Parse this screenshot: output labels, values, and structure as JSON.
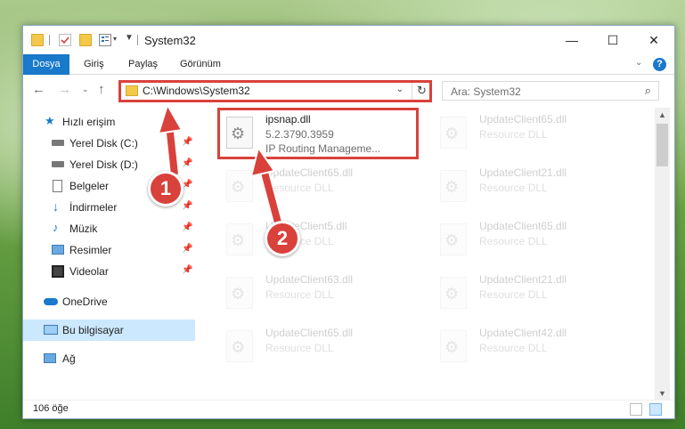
{
  "window": {
    "title": "System32",
    "controls": {
      "minimize": "—",
      "maximize": "☐",
      "close": "✕"
    }
  },
  "ribbon": {
    "tabs": [
      {
        "label": "Dosya"
      },
      {
        "label": "Giriş"
      },
      {
        "label": "Paylaş"
      },
      {
        "label": "Görünüm"
      }
    ],
    "help": "?"
  },
  "address": {
    "path": "C:\\Windows\\System32",
    "search_placeholder": "Ara: System32"
  },
  "sidebar": {
    "items": [
      {
        "label": "Hızlı erişim",
        "icon": "star-icon",
        "pinned": false
      },
      {
        "label": "Yerel Disk (C:)",
        "icon": "drive-icon",
        "pinned": true
      },
      {
        "label": "Yerel Disk (D:)",
        "icon": "drive-icon",
        "pinned": true
      },
      {
        "label": "Belgeler",
        "icon": "documents-icon",
        "pinned": true
      },
      {
        "label": "İndirmeler",
        "icon": "download-icon",
        "pinned": true
      },
      {
        "label": "Müzik",
        "icon": "music-icon",
        "pinned": true
      },
      {
        "label": "Resimler",
        "icon": "pictures-icon",
        "pinned": true
      },
      {
        "label": "Videolar",
        "icon": "video-icon",
        "pinned": true
      },
      {
        "label": "OneDrive",
        "icon": "cloud-icon",
        "pinned": false
      },
      {
        "label": "Bu bilgisayar",
        "icon": "computer-icon",
        "pinned": false,
        "selected": true
      },
      {
        "label": "Ağ",
        "icon": "network-icon",
        "pinned": false
      }
    ]
  },
  "files": [
    {
      "name": "ipsnap.dll",
      "line2": "5.2.3790.3959",
      "line3": "IP Routing Manageme...",
      "highlighted": true
    },
    {
      "name": "UpdateClient65.dll",
      "line2": "Resource DLL"
    },
    {
      "name": "UpdateClient65.dll",
      "line2": "Resource DLL"
    },
    {
      "name": "UpdateClient21.dll",
      "line2": "Resource DLL"
    },
    {
      "name": "UpdateClient5.dll",
      "line2": "Resource DLL"
    },
    {
      "name": "UpdateClient65.dll",
      "line2": "Resource DLL"
    },
    {
      "name": "UpdateClient63.dll",
      "line2": "Resource DLL"
    },
    {
      "name": "UpdateClient21.dll",
      "line2": "Resource DLL"
    },
    {
      "name": "UpdateClient65.dll",
      "line2": "Resource DLL"
    },
    {
      "name": "UpdateClient42.dll",
      "line2": "Resource DLL"
    }
  ],
  "status": {
    "count": "106 öğe"
  },
  "callouts": {
    "one": "1",
    "two": "2"
  },
  "colors": {
    "accent": "#1979ca",
    "callout": "#d9413b",
    "selected": "#cce8ff"
  }
}
